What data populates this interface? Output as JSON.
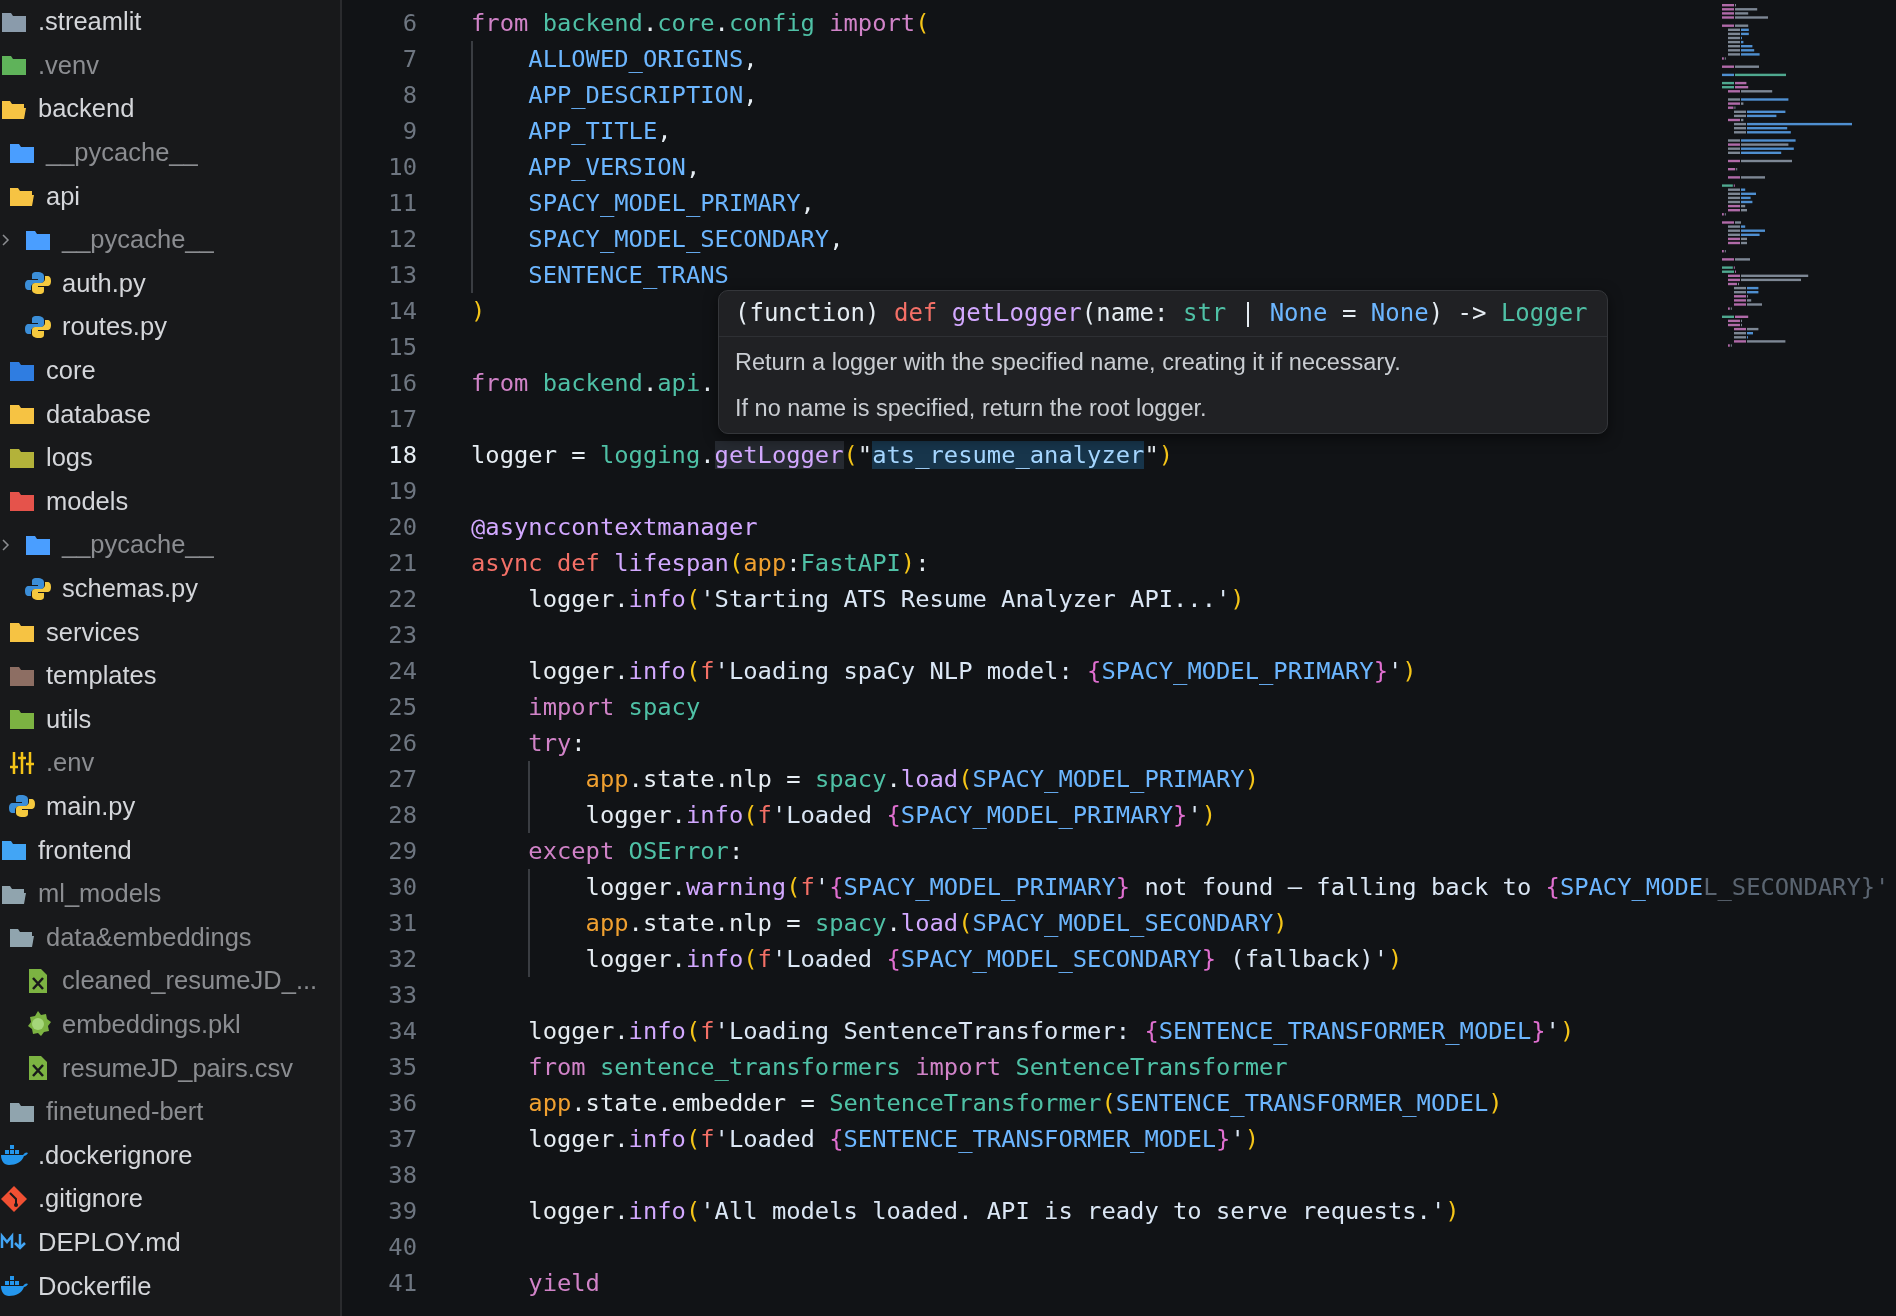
{
  "explorer": {
    "items": [
      {
        "label": ".streamlit",
        "kind": "folder",
        "color": "#8a9bab",
        "expanded": false,
        "dimmed": false
      },
      {
        "label": ".venv",
        "kind": "folder",
        "color": "#5fb35a",
        "expanded": false,
        "dimmed": true
      },
      {
        "label": "backend",
        "kind": "folder",
        "color": "#f6c343",
        "expanded": true,
        "dimmed": false,
        "children": [
          {
            "label": "__pycache__",
            "kind": "folder",
            "color": "#4a9eff",
            "expanded": false,
            "dimmed": true
          },
          {
            "label": "api",
            "kind": "folder",
            "color": "#f6c343",
            "expanded": true,
            "dimmed": false,
            "children": [
              {
                "label": "__pycache__",
                "kind": "folder",
                "color": "#4a9eff",
                "expanded": false,
                "dimmed": true
              },
              {
                "label": "auth.py",
                "kind": "python",
                "dimmed": false
              },
              {
                "label": "routes.py",
                "kind": "python",
                "dimmed": false
              }
            ]
          },
          {
            "label": "core",
            "kind": "folder",
            "color": "#2f7de1",
            "expanded": false,
            "dimmed": false
          },
          {
            "label": "database",
            "kind": "folder",
            "color": "#f6c343",
            "expanded": false,
            "dimmed": false
          },
          {
            "label": "logs",
            "kind": "folder",
            "color": "#b3b23a",
            "expanded": false,
            "dimmed": false
          },
          {
            "label": "models",
            "kind": "folder",
            "color": "#e5534b",
            "expanded": false,
            "dimmed": false,
            "children": [
              {
                "label": "__pycache__",
                "kind": "folder",
                "color": "#4a9eff",
                "expanded": false,
                "dimmed": true
              },
              {
                "label": "schemas.py",
                "kind": "python",
                "dimmed": false
              }
            ]
          },
          {
            "label": "services",
            "kind": "folder",
            "color": "#f6c343",
            "expanded": false,
            "dimmed": false
          },
          {
            "label": "templates",
            "kind": "folder",
            "color": "#8d6e63",
            "expanded": false,
            "dimmed": false
          },
          {
            "label": "utils",
            "kind": "folder",
            "color": "#7cb342",
            "expanded": false,
            "dimmed": false
          },
          {
            "label": ".env",
            "kind": "env",
            "dimmed": true
          },
          {
            "label": "main.py",
            "kind": "python",
            "dimmed": false
          }
        ]
      },
      {
        "label": "frontend",
        "kind": "folder",
        "color": "#42a5f5",
        "expanded": false,
        "dimmed": false
      },
      {
        "label": "ml_models",
        "kind": "folder",
        "color": "#90a4ae",
        "expanded": true,
        "dimmed": true,
        "children": [
          {
            "label": "data&embeddings",
            "kind": "folder",
            "color": "#90a4ae",
            "expanded": true,
            "dimmed": true,
            "children": [
              {
                "label": "cleaned_resumeJD_...",
                "kind": "csv",
                "dimmed": true
              },
              {
                "label": "embeddings.pkl",
                "kind": "pickle",
                "dimmed": true
              },
              {
                "label": "resumeJD_pairs.csv",
                "kind": "csv",
                "dimmed": true
              }
            ]
          },
          {
            "label": "finetuned-bert",
            "kind": "folder",
            "color": "#90a4ae",
            "expanded": false,
            "dimmed": true
          }
        ]
      },
      {
        "label": ".dockerignore",
        "kind": "docker",
        "dimmed": false
      },
      {
        "label": ".gitignore",
        "kind": "git",
        "dimmed": false
      },
      {
        "label": "DEPLOY.md",
        "kind": "markdown",
        "dimmed": false
      },
      {
        "label": "Dockerfile",
        "kind": "docker",
        "dimmed": false
      }
    ]
  },
  "code": {
    "lines": [
      {
        "number": "6",
        "current": false,
        "guide": false,
        "tokens": [
          {
            "text": "from ",
            "kind": "kw"
          },
          {
            "text": "backend",
            "kind": "mod"
          },
          {
            "text": ".",
            "kind": "p"
          },
          {
            "text": "core",
            "kind": "mod"
          },
          {
            "text": ".",
            "kind": "p"
          },
          {
            "text": "config ",
            "kind": "mod"
          },
          {
            "text": "import",
            "kind": "kw"
          },
          {
            "text": "(",
            "kind": "paren"
          }
        ]
      },
      {
        "number": "7",
        "current": false,
        "guide": true,
        "tokens": [
          {
            "text": "    ALLOWED_ORIGINS",
            "kind": "const"
          },
          {
            "text": ",",
            "kind": "p"
          }
        ]
      },
      {
        "number": "8",
        "current": false,
        "guide": true,
        "tokens": [
          {
            "text": "    APP_DESCRIPTION",
            "kind": "const"
          },
          {
            "text": ",",
            "kind": "p"
          }
        ]
      },
      {
        "number": "9",
        "current": false,
        "guide": true,
        "tokens": [
          {
            "text": "    APP_TITLE",
            "kind": "const"
          },
          {
            "text": ",",
            "kind": "p"
          }
        ]
      },
      {
        "number": "10",
        "current": false,
        "guide": true,
        "tokens": [
          {
            "text": "    APP_VERSION",
            "kind": "const"
          },
          {
            "text": ",",
            "kind": "p"
          }
        ]
      },
      {
        "number": "11",
        "current": false,
        "guide": true,
        "tokens": [
          {
            "text": "    SPACY_MODEL_PRIMARY",
            "kind": "const"
          },
          {
            "text": ",",
            "kind": "p"
          }
        ]
      },
      {
        "number": "12",
        "current": false,
        "guide": true,
        "tokens": [
          {
            "text": "    SPACY_MODEL_SECONDARY",
            "kind": "const"
          },
          {
            "text": ",",
            "kind": "p"
          }
        ]
      },
      {
        "number": "13",
        "current": false,
        "guide": true,
        "tokens": [
          {
            "text": "    SENTENCE_TRANS",
            "kind": "const"
          }
        ]
      },
      {
        "number": "14",
        "current": false,
        "guide": false,
        "tokens": [
          {
            "text": ")",
            "kind": "paren"
          }
        ]
      },
      {
        "number": "15",
        "current": false,
        "guide": false
      },
      {
        "number": "16",
        "current": false,
        "guide": false,
        "tokens": [
          {
            "text": "from ",
            "kind": "kw"
          },
          {
            "text": "backend",
            "kind": "mod"
          },
          {
            "text": ".",
            "kind": "p"
          },
          {
            "text": "api",
            "kind": "mod"
          },
          {
            "text": ".",
            "kind": "p"
          }
        ]
      },
      {
        "number": "17",
        "current": false,
        "guide": false
      },
      {
        "number": "18",
        "current": true,
        "guide": false,
        "tokens": [
          {
            "text": "logger = ",
            "kind": "p"
          },
          {
            "text": "logging",
            "kind": "mod"
          },
          {
            "text": ".",
            "kind": "p"
          },
          {
            "text": "getLogger",
            "kind": "fn-hover"
          },
          {
            "text": "(",
            "kind": "paren"
          },
          {
            "text": "\"",
            "kind": "p"
          },
          {
            "text": "ats_resume_analyzer",
            "kind": "str-selected"
          },
          {
            "text": "\"",
            "kind": "p"
          },
          {
            "text": ")",
            "kind": "paren"
          }
        ]
      },
      {
        "number": "19",
        "current": false,
        "guide": false
      },
      {
        "number": "20",
        "current": false,
        "guide": false,
        "tokens": [
          {
            "text": "@asynccontextmanager",
            "kind": "fn"
          }
        ]
      },
      {
        "number": "21",
        "current": false,
        "guide": false,
        "tokens": [
          {
            "text": "async def ",
            "kind": "def"
          },
          {
            "text": "lifespan",
            "kind": "fn"
          },
          {
            "text": "(",
            "kind": "paren"
          },
          {
            "text": "app",
            "kind": "app"
          },
          {
            "text": ":",
            "kind": "p"
          },
          {
            "text": "FastAPI",
            "kind": "type"
          },
          {
            "text": ")",
            "kind": "paren"
          },
          {
            "text": ":",
            "kind": "p"
          }
        ]
      },
      {
        "number": "22",
        "current": false,
        "guide": false,
        "tokens": [
          {
            "text": "    logger.",
            "kind": "p"
          },
          {
            "text": "info",
            "kind": "fn"
          },
          {
            "text": "(",
            "kind": "paren"
          },
          {
            "text": "'Starting ATS Resume Analyzer API...'",
            "kind": "str"
          },
          {
            "text": ")",
            "kind": "paren"
          }
        ]
      },
      {
        "number": "23",
        "current": false,
        "guide": false
      },
      {
        "number": "24",
        "current": false,
        "guide": false,
        "tokens": [
          {
            "text": "    logger.",
            "kind": "p"
          },
          {
            "text": "info",
            "kind": "fn"
          },
          {
            "text": "(",
            "kind": "paren"
          },
          {
            "text": "f",
            "kind": "def"
          },
          {
            "text": "'Loading spaCy NLP model: ",
            "kind": "str"
          },
          {
            "text": "{",
            "kind": "brace"
          },
          {
            "text": "SPACY_MODEL_PRIMARY",
            "kind": "const"
          },
          {
            "text": "}",
            "kind": "brace"
          },
          {
            "text": "'",
            "kind": "str"
          },
          {
            "text": ")",
            "kind": "paren"
          }
        ]
      },
      {
        "number": "25",
        "current": false,
        "guide": false,
        "tokens": [
          {
            "text": "    import ",
            "kind": "kw"
          },
          {
            "text": "spacy",
            "kind": "mod"
          }
        ]
      },
      {
        "number": "26",
        "current": false,
        "guide": false,
        "tokens": [
          {
            "text": "    try",
            "kind": "kw"
          },
          {
            "text": ":",
            "kind": "p"
          }
        ]
      },
      {
        "number": "27",
        "current": false,
        "guide": true,
        "tokens": [
          {
            "text": "        app",
            "kind": "app"
          },
          {
            "text": ".state.nlp = ",
            "kind": "p"
          },
          {
            "text": "spacy",
            "kind": "mod"
          },
          {
            "text": ".",
            "kind": "p"
          },
          {
            "text": "load",
            "kind": "fn"
          },
          {
            "text": "(",
            "kind": "paren"
          },
          {
            "text": "SPACY_MODEL_PRIMARY",
            "kind": "const"
          },
          {
            "text": ")",
            "kind": "paren"
          }
        ]
      },
      {
        "number": "28",
        "current": false,
        "guide": true,
        "tokens": [
          {
            "text": "        logger.",
            "kind": "p"
          },
          {
            "text": "info",
            "kind": "fn"
          },
          {
            "text": "(",
            "kind": "paren"
          },
          {
            "text": "f",
            "kind": "def"
          },
          {
            "text": "'Loaded ",
            "kind": "str"
          },
          {
            "text": "{",
            "kind": "brace"
          },
          {
            "text": "SPACY_MODEL_PRIMARY",
            "kind": "const"
          },
          {
            "text": "}",
            "kind": "brace"
          },
          {
            "text": "'",
            "kind": "str"
          },
          {
            "text": ")",
            "kind": "paren"
          }
        ]
      },
      {
        "number": "29",
        "current": false,
        "guide": false,
        "tokens": [
          {
            "text": "    except ",
            "kind": "kw"
          },
          {
            "text": "OSError",
            "kind": "type"
          },
          {
            "text": ":",
            "kind": "p"
          }
        ]
      },
      {
        "number": "30",
        "current": false,
        "guide": true,
        "tokens": [
          {
            "text": "        logger.",
            "kind": "p"
          },
          {
            "text": "warning",
            "kind": "fn"
          },
          {
            "text": "(",
            "kind": "paren"
          },
          {
            "text": "f",
            "kind": "def"
          },
          {
            "text": "'",
            "kind": "str"
          },
          {
            "text": "{",
            "kind": "brace"
          },
          {
            "text": "SPACY_MODEL_PRIMARY",
            "kind": "const"
          },
          {
            "text": "}",
            "kind": "brace"
          },
          {
            "text": " not found — falling back to ",
            "kind": "str"
          },
          {
            "text": "{",
            "kind": "brace"
          },
          {
            "text": "SPACY_MODE",
            "kind": "const"
          },
          {
            "text": "L_SECONDARY}'",
            "kind": "faded"
          }
        ]
      },
      {
        "number": "31",
        "current": false,
        "guide": true,
        "tokens": [
          {
            "text": "        app",
            "kind": "app"
          },
          {
            "text": ".state.nlp = ",
            "kind": "p"
          },
          {
            "text": "spacy",
            "kind": "mod"
          },
          {
            "text": ".",
            "kind": "p"
          },
          {
            "text": "load",
            "kind": "fn"
          },
          {
            "text": "(",
            "kind": "paren"
          },
          {
            "text": "SPACY_MODEL_SECONDARY",
            "kind": "const"
          },
          {
            "text": ")",
            "kind": "paren"
          }
        ]
      },
      {
        "number": "32",
        "current": false,
        "guide": true,
        "tokens": [
          {
            "text": "        logger.",
            "kind": "p"
          },
          {
            "text": "info",
            "kind": "fn"
          },
          {
            "text": "(",
            "kind": "paren"
          },
          {
            "text": "f",
            "kind": "def"
          },
          {
            "text": "'Loaded ",
            "kind": "str"
          },
          {
            "text": "{",
            "kind": "brace"
          },
          {
            "text": "SPACY_MODEL_SECONDARY",
            "kind": "const"
          },
          {
            "text": "}",
            "kind": "brace"
          },
          {
            "text": " (fallback)'",
            "kind": "str"
          },
          {
            "text": ")",
            "kind": "paren"
          }
        ]
      },
      {
        "number": "33",
        "current": false,
        "guide": false
      },
      {
        "number": "34",
        "current": false,
        "guide": false,
        "tokens": [
          {
            "text": "    logger.",
            "kind": "p"
          },
          {
            "text": "info",
            "kind": "fn"
          },
          {
            "text": "(",
            "kind": "paren"
          },
          {
            "text": "f",
            "kind": "def"
          },
          {
            "text": "'Loading SentenceTransformer: ",
            "kind": "str"
          },
          {
            "text": "{",
            "kind": "brace"
          },
          {
            "text": "SENTENCE_TRANSFORMER_MODEL",
            "kind": "const"
          },
          {
            "text": "}",
            "kind": "brace"
          },
          {
            "text": "'",
            "kind": "str"
          },
          {
            "text": ")",
            "kind": "paren"
          }
        ]
      },
      {
        "number": "35",
        "current": false,
        "guide": false,
        "tokens": [
          {
            "text": "    from ",
            "kind": "kw"
          },
          {
            "text": "sentence_transformers ",
            "kind": "mod"
          },
          {
            "text": "import ",
            "kind": "kw"
          },
          {
            "text": "SentenceTransformer",
            "kind": "type"
          }
        ]
      },
      {
        "number": "36",
        "current": false,
        "guide": false,
        "tokens": [
          {
            "text": "    app",
            "kind": "app"
          },
          {
            "text": ".state.embedder = ",
            "kind": "p"
          },
          {
            "text": "SentenceTransformer",
            "kind": "type"
          },
          {
            "text": "(",
            "kind": "paren"
          },
          {
            "text": "SENTENCE_TRANSFORMER_MODEL",
            "kind": "const"
          },
          {
            "text": ")",
            "kind": "paren"
          }
        ]
      },
      {
        "number": "37",
        "current": false,
        "guide": false,
        "tokens": [
          {
            "text": "    logger.",
            "kind": "p"
          },
          {
            "text": "info",
            "kind": "fn"
          },
          {
            "text": "(",
            "kind": "paren"
          },
          {
            "text": "f",
            "kind": "def"
          },
          {
            "text": "'Loaded ",
            "kind": "str"
          },
          {
            "text": "{",
            "kind": "brace"
          },
          {
            "text": "SENTENCE_TRANSFORMER_MODEL",
            "kind": "const"
          },
          {
            "text": "}",
            "kind": "brace"
          },
          {
            "text": "'",
            "kind": "str"
          },
          {
            "text": ")",
            "kind": "paren"
          }
        ]
      },
      {
        "number": "38",
        "current": false,
        "guide": false
      },
      {
        "number": "39",
        "current": false,
        "guide": false,
        "tokens": [
          {
            "text": "    logger.",
            "kind": "p"
          },
          {
            "text": "info",
            "kind": "fn"
          },
          {
            "text": "(",
            "kind": "paren"
          },
          {
            "text": "'All models loaded. API is ready to serve requests.'",
            "kind": "str"
          },
          {
            "text": ")",
            "kind": "paren"
          }
        ]
      },
      {
        "number": "40",
        "current": false,
        "guide": false
      },
      {
        "number": "41",
        "current": false,
        "guide": false,
        "tokens": [
          {
            "text": "    yield",
            "kind": "kw"
          }
        ]
      }
    ]
  },
  "tooltip": {
    "signature": [
      {
        "text": "(function) ",
        "kind": "p"
      },
      {
        "text": "def ",
        "kind": "def"
      },
      {
        "text": "getLogger",
        "kind": "fn"
      },
      {
        "text": "(name: ",
        "kind": "p"
      },
      {
        "text": "str",
        "kind": "type"
      },
      {
        "text": " | ",
        "kind": "p"
      },
      {
        "text": "None",
        "kind": "const"
      },
      {
        "text": " = ",
        "kind": "p"
      },
      {
        "text": "None",
        "kind": "const"
      },
      {
        "text": ") -> ",
        "kind": "p"
      },
      {
        "text": "Logger",
        "kind": "type"
      }
    ],
    "paragraphs": [
      "Return a logger with the specified name, creating it if necessary.",
      "If no name is specified, return the root logger."
    ]
  }
}
